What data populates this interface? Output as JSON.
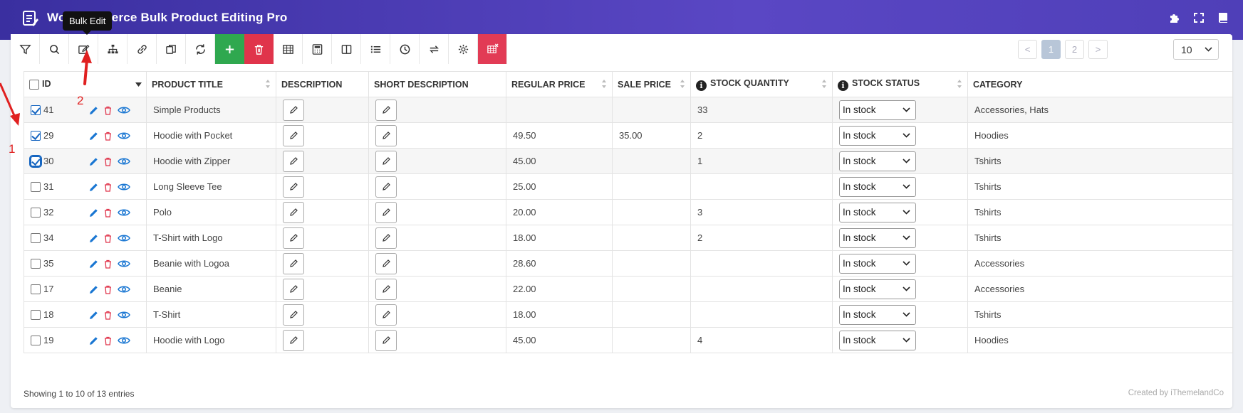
{
  "app": {
    "title": "WooCommerce Bulk Product Editing Pro"
  },
  "tooltip": "Bulk Edit",
  "toolbar": {
    "buttons": [
      "filter",
      "search",
      "bulk-edit",
      "taxonomy",
      "link",
      "duplicate",
      "refresh",
      "add",
      "delete",
      "table",
      "grid",
      "columns",
      "list",
      "history",
      "sync",
      "settings",
      "delete-table"
    ]
  },
  "pagination": {
    "prev": "<",
    "pages": [
      "1",
      "2"
    ],
    "next": ">",
    "current": "1",
    "per_page": "10"
  },
  "table": {
    "headers": {
      "id": "ID",
      "title": "PRODUCT TITLE",
      "description": "DESCRIPTION",
      "short_description": "SHORT DESCRIPTION",
      "regular_price": "REGULAR PRICE",
      "sale_price": "SALE PRICE",
      "stock_quantity": "STOCK QUANTITY",
      "stock_status": "STOCK STATUS",
      "category": "CATEGORY"
    },
    "rows": [
      {
        "id": "41",
        "checked": true,
        "title": "Simple Products",
        "regular": "",
        "sale": "",
        "qty": "33",
        "status": "In stock",
        "category": "Accessories, Hats"
      },
      {
        "id": "29",
        "checked": true,
        "title": "Hoodie with Pocket",
        "regular": "49.50",
        "sale": "35.00",
        "qty": "2",
        "status": "In stock",
        "category": "Hoodies"
      },
      {
        "id": "30",
        "checked": true,
        "title": "Hoodie with Zipper",
        "regular": "45.00",
        "sale": "",
        "qty": "1",
        "status": "In stock",
        "category": "Tshirts"
      },
      {
        "id": "31",
        "checked": false,
        "title": "Long Sleeve Tee",
        "regular": "25.00",
        "sale": "",
        "qty": "",
        "status": "In stock",
        "category": "Tshirts"
      },
      {
        "id": "32",
        "checked": false,
        "title": "Polo",
        "regular": "20.00",
        "sale": "",
        "qty": "3",
        "status": "In stock",
        "category": "Tshirts"
      },
      {
        "id": "34",
        "checked": false,
        "title": "T-Shirt with Logo",
        "regular": "18.00",
        "sale": "",
        "qty": "2",
        "status": "In stock",
        "category": "Tshirts"
      },
      {
        "id": "35",
        "checked": false,
        "title": "Beanie with Logoa",
        "regular": "28.60",
        "sale": "",
        "qty": "",
        "status": "In stock",
        "category": "Accessories"
      },
      {
        "id": "17",
        "checked": false,
        "title": "Beanie",
        "regular": "22.00",
        "sale": "",
        "qty": "",
        "status": "In stock",
        "category": "Accessories"
      },
      {
        "id": "18",
        "checked": false,
        "title": "T-Shirt",
        "regular": "18.00",
        "sale": "",
        "qty": "",
        "status": "In stock",
        "category": "Tshirts"
      },
      {
        "id": "19",
        "checked": false,
        "title": "Hoodie with Logo",
        "regular": "45.00",
        "sale": "",
        "qty": "4",
        "status": "In stock",
        "category": "Hoodies"
      }
    ]
  },
  "footer": {
    "entries": "Showing 1 to 10 of 13 entries",
    "credit": "Created by iThemelandCo"
  },
  "annotations": {
    "one": "1",
    "two": "2"
  },
  "colors": {
    "header_gradient_start": "#3a2fa0",
    "header_gradient_end": "#5a47c4",
    "add": "#2fa84f",
    "delete": "#e0344b",
    "accent": "#1565c0",
    "annotation": "#e02020"
  }
}
